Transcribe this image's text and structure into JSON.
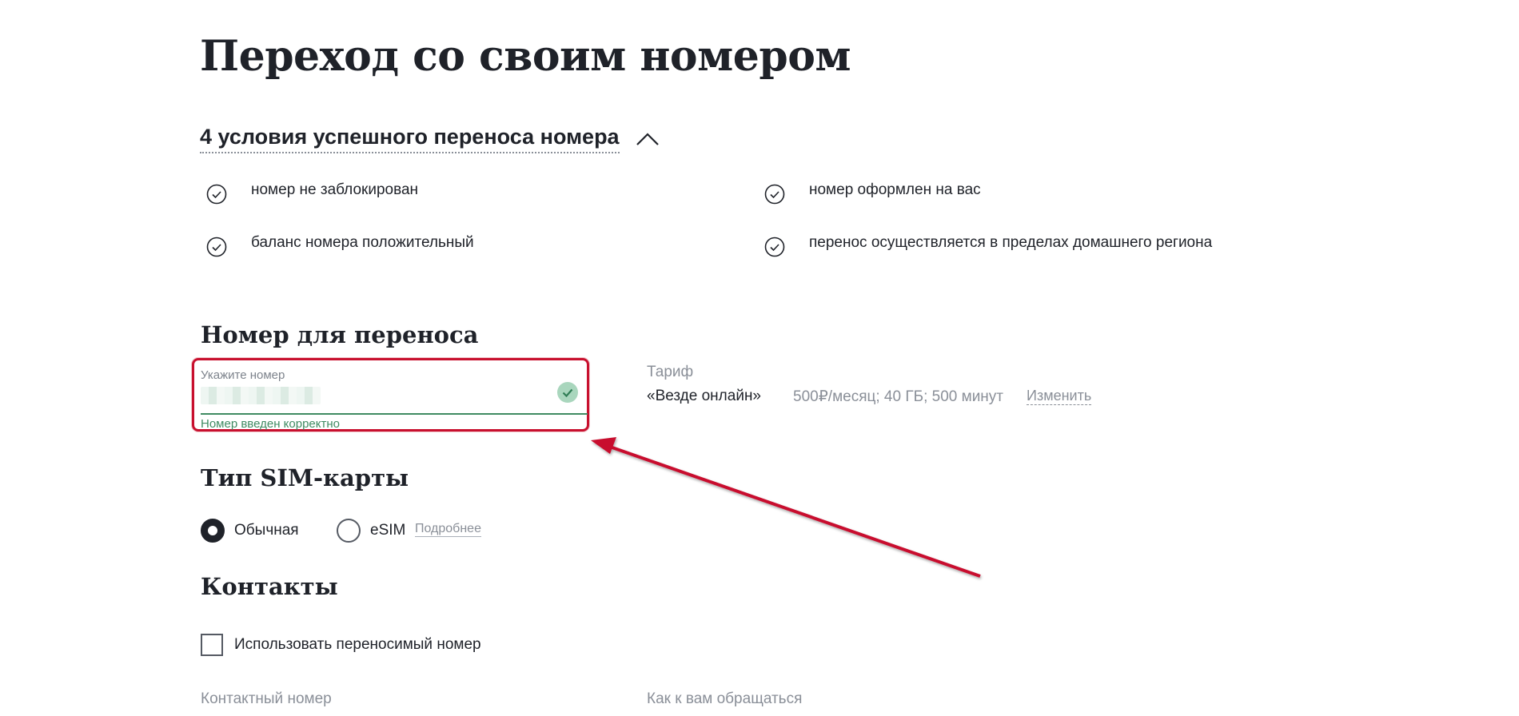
{
  "page": {
    "title": "Переход со своим номером"
  },
  "conditions": {
    "toggle_label": "4 условия успешного переноса номера",
    "items": [
      "номер не заблокирован",
      "номер оформлен на вас",
      "баланс номера положительный",
      "перенос осуществляется в пределах домашнего региона"
    ]
  },
  "number_section": {
    "heading": "Номер для переноса",
    "input_label": "Укажите номер",
    "input_value_masked": true,
    "validation_message": "Номер введен корректно"
  },
  "tariff": {
    "label": "Тариф",
    "name": "«Везде онлайн»",
    "details": "500₽/месяц; 40 ГБ; 500 минут",
    "change_link": "Изменить"
  },
  "sim_section": {
    "heading": "Тип SIM-карты",
    "options": [
      {
        "label": "Обычная",
        "selected": true
      },
      {
        "label": "eSIM",
        "selected": false
      }
    ],
    "more_link": "Подробнее"
  },
  "contacts": {
    "heading": "Контакты",
    "use_number_checkbox": "Использовать переносимый номер",
    "use_number_checked": false,
    "contact_number_label": "Контактный номер",
    "name_label": "Как к вам обращаться"
  },
  "colors": {
    "text": "#1f2229",
    "muted": "#8a8f98",
    "success": "#3f8b62",
    "annotation": "#c8102e"
  },
  "icons": [
    "chevron-up-icon",
    "check-circle-icon",
    "valid-check-icon"
  ]
}
